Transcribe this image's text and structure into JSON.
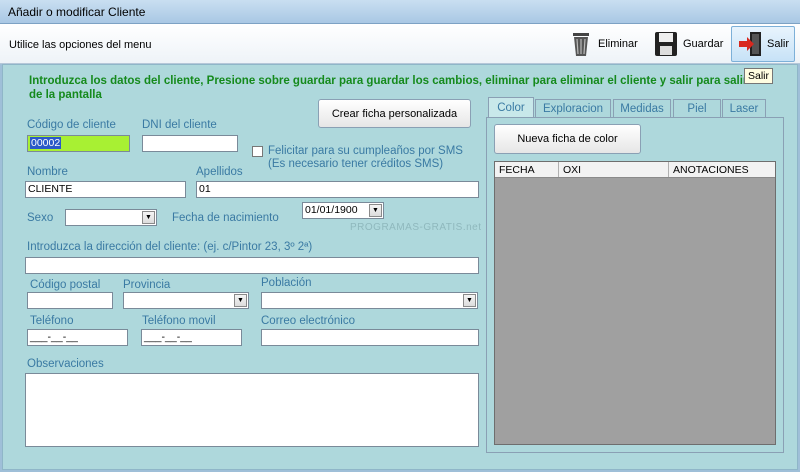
{
  "window": {
    "title": "Añadir o modificar Cliente"
  },
  "toolbar": {
    "hint": "Utilice las opciones del menu",
    "eliminar_label": "Eliminar",
    "guardar_label": "Guardar",
    "salir_label": "Salir"
  },
  "tooltip": "Salir",
  "instructions": "Introduzca los datos del cliente, Presione sobre guardar para guardar los cambios, eliminar para eliminar el cliente y salir para salir de la pantalla",
  "buttons": {
    "crear_ficha": "Crear ficha personalizada",
    "nueva_ficha_color": "Nueva ficha de color"
  },
  "fields": {
    "codigo_label": "Código de cliente",
    "codigo_value": "00002",
    "dni_label": "DNI del cliente",
    "dni_value": "",
    "sms_label": "Felicitar para su cumpleaños por SMS",
    "sms_note": "(Es necesario tener créditos SMS)",
    "nombre_label": "Nombre",
    "nombre_value": "CLIENTE",
    "apellidos_label": "Apellidos",
    "apellidos_value": "01",
    "sexo_label": "Sexo",
    "sexo_value": "",
    "fecha_label": "Fecha de nacimiento",
    "fecha_value": "01/01/1900",
    "direccion_label": "Introduzca la dirección del cliente: (ej. c/Pintor 23, 3º 2ª)",
    "direccion_value": "",
    "cp_label": "Código postal",
    "cp_value": "",
    "provincia_label": "Provincia",
    "provincia_value": "",
    "poblacion_label": "Población",
    "poblacion_value": "",
    "telefono_label": "Teléfono",
    "telefono_value": "___-__-__",
    "movil_label": "Teléfono movil",
    "movil_value": "___-__-__",
    "correo_label": "Correo electrónico",
    "correo_value": "",
    "observaciones_label": "Observaciones",
    "observaciones_value": ""
  },
  "tabs": [
    {
      "label": "Color",
      "selected": true
    },
    {
      "label": "Exploracion"
    },
    {
      "label": "Medidas"
    },
    {
      "label": "Piel"
    },
    {
      "label": "Laser"
    }
  ],
  "grid": {
    "columns": [
      "FECHA",
      "OXI",
      "ANOTACIONES"
    ]
  },
  "watermark": "PROGRAMAS-GRATIS.net",
  "colors": {
    "client_bg": "#aed8dc",
    "label": "#3a7aa3",
    "instructions": "#158a1c",
    "highlight_input": "#a8f033"
  }
}
